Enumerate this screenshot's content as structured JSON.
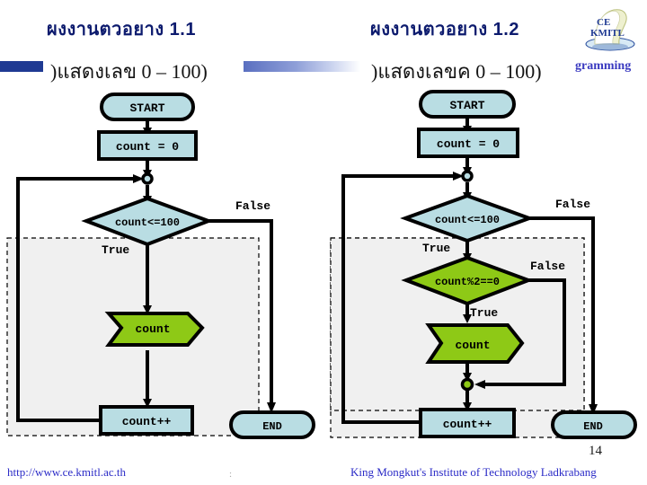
{
  "slide": {
    "page_number": "14",
    "logo": {
      "name": "kmitl-ce-logo",
      "line1": "CE",
      "line2": "KMITL"
    },
    "decor": {
      "solid_bar_color": "#1f3a93",
      "gradient_bar_from": "#5a6fc0",
      "gradient_bar_to": "#ffffff",
      "gramming_text": "gramming",
      "gramming_color": "#3a3ac0"
    },
    "footer": {
      "url": "http://www.ce.kmitl.ac.th",
      "institution": "King Mongkut's Institute of Technology Ladkrabang",
      "color": "#2b2bc7"
    }
  },
  "panels": [
    {
      "id": "left",
      "title": "ผงงานตวอยาง  1.1",
      "subtitle": ")แสดงเลข 0 – 100)",
      "title_color": "#0d1b6e",
      "flow": {
        "start": "START",
        "init": "count = 0",
        "condition": "count<=100",
        "cond_true": "True",
        "cond_false": "False",
        "output": "count",
        "increment": "count++",
        "end": "END"
      }
    },
    {
      "id": "right",
      "title": "ผงงานตวอยาง  1.2",
      "subtitle": ")แสดงเลขค 0 – 100)",
      "title_color": "#0d1b6e",
      "flow": {
        "start": "START",
        "init": "count = 0",
        "condition": "count<=100",
        "cond_true": "True",
        "cond_false": "False",
        "condition2": "count%2==0",
        "cond2_true": "True",
        "cond2_false": "False",
        "output": "count",
        "increment": "count++",
        "end": "END"
      }
    }
  ],
  "colors": {
    "shape_blue_fill": "#b9dde3",
    "shape_green_fill": "#8ec916",
    "shape_stroke": "#000000",
    "dashed_group_fill": "#f0f0f0"
  }
}
